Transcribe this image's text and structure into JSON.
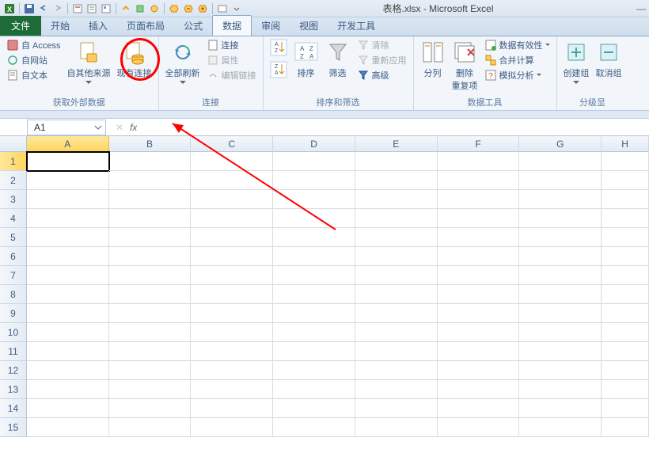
{
  "title": "表格.xlsx - Microsoft Excel",
  "tabs": {
    "file": "文件",
    "items": [
      "开始",
      "插入",
      "页面布局",
      "公式",
      "数据",
      "审阅",
      "视图",
      "开发工具"
    ],
    "active": "数据"
  },
  "ribbon": {
    "externalData": {
      "access": "自 Access",
      "web": "自网站",
      "text": "自文本",
      "other": "自其他来源",
      "existing": "现有连接",
      "label": "获取外部数据"
    },
    "connections": {
      "refresh": "全部刷新",
      "conn": "连接",
      "props": "属性",
      "editLinks": "编辑链接",
      "label": "连接"
    },
    "sortFilter": {
      "sort": "排序",
      "filter": "筛选",
      "clear": "清除",
      "reapply": "重新应用",
      "advanced": "高级",
      "label": "排序和筛选"
    },
    "dataTools": {
      "textToCols": "分列",
      "removeDup": "删除\n重复项",
      "validation": "数据有效性",
      "consolidate": "合并计算",
      "whatif": "模拟分析",
      "label": "数据工具"
    },
    "outline": {
      "group": "创建组",
      "ungroup": "取消组",
      "label": "分级显"
    }
  },
  "namebox": "A1",
  "columns": [
    "A",
    "B",
    "C",
    "D",
    "E",
    "F",
    "G",
    "H"
  ],
  "rows": [
    "1",
    "2",
    "3",
    "4",
    "5",
    "6",
    "7",
    "8",
    "9",
    "10",
    "11",
    "12",
    "13",
    "14",
    "15"
  ],
  "selectedCell": {
    "row": 0,
    "col": 0
  }
}
